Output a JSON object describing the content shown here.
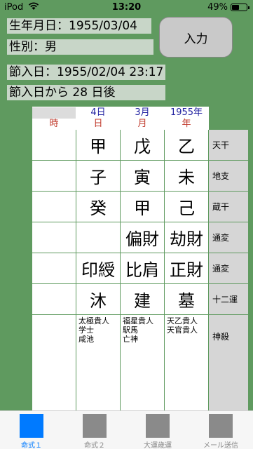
{
  "status": {
    "carrier": "iPod",
    "time": "13:20",
    "battery": "49%",
    "battery_level": 0.49
  },
  "info": {
    "birthdate": "生年月日：1955/03/04",
    "gender": "性別：男",
    "setsuiri": "節入日：1955/02/04 23:17",
    "days_after": "節入日から 28 日後"
  },
  "input_button": "入力",
  "header": {
    "dates": [
      "",
      "4日",
      "3月",
      "1955年"
    ],
    "pillars": [
      "時",
      "日",
      "月",
      "年"
    ]
  },
  "rows": [
    {
      "label": "天干",
      "cells": [
        "",
        "甲",
        "戊",
        "乙"
      ]
    },
    {
      "label": "地支",
      "cells": [
        "",
        "子",
        "寅",
        "未"
      ]
    },
    {
      "label": "蔵干",
      "cells": [
        "",
        "癸",
        "甲",
        "己"
      ]
    },
    {
      "label": "通変",
      "cells": [
        "",
        "",
        "偏財",
        "劫財"
      ]
    },
    {
      "label": "通変",
      "cells": [
        "",
        "印綬",
        "比肩",
        "正財"
      ]
    },
    {
      "label": "十二運",
      "cells": [
        "",
        "沐",
        "建",
        "墓"
      ]
    }
  ],
  "shinsatsu": {
    "label": "神殺",
    "columns": [
      [],
      [
        "太極貴人",
        "学士",
        "咸池"
      ],
      [
        "福星貴人",
        "駅馬",
        "亡神"
      ],
      [
        "天乙貴人",
        "天官貴人"
      ]
    ]
  },
  "tabs": [
    {
      "label": "命式１",
      "active": true
    },
    {
      "label": "命式２",
      "active": false
    },
    {
      "label": "大運歳運",
      "active": false
    },
    {
      "label": "メール送信",
      "active": false
    }
  ],
  "colors": {
    "background": "#5f9a5f",
    "active_tab": "#007aff",
    "pillar_label": "#c0392b",
    "date_label": "#1f1fa0"
  }
}
